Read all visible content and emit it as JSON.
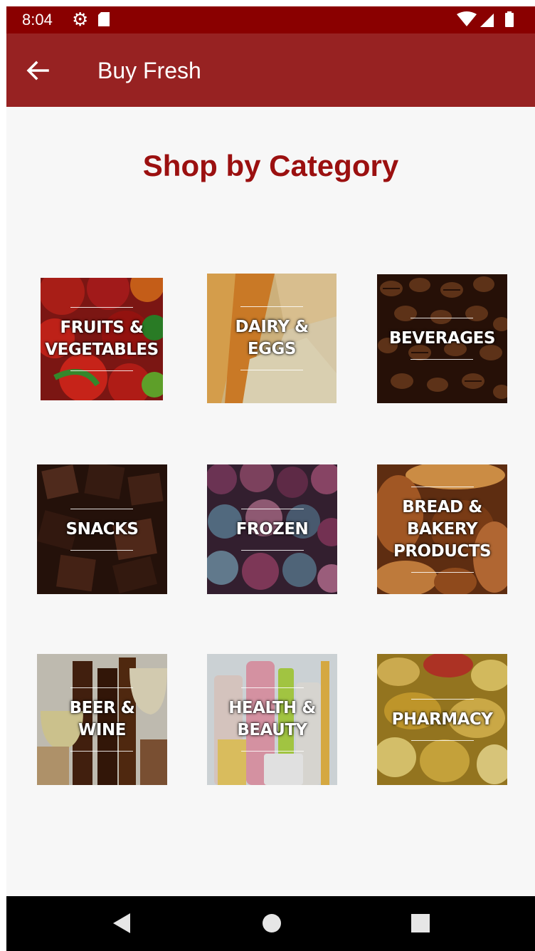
{
  "status_bar": {
    "time": "8:04",
    "icons": [
      "gear-icon",
      "sd-card-icon",
      "wifi-icon",
      "signal-icon",
      "battery-icon"
    ]
  },
  "app_bar": {
    "title": "Buy Fresh",
    "back_icon": "arrow-left-icon",
    "color": "#972222"
  },
  "heading": "Shop by Category",
  "accent_color": "#9b1010",
  "categories": [
    {
      "label": "FRUITS &\nVEGETABLES",
      "image": "fruits-vegetables"
    },
    {
      "label": "DAIRY &\nEGGS",
      "image": "dairy-eggs"
    },
    {
      "label": "BEVERAGES",
      "image": "coffee-beans"
    },
    {
      "label": "SNACKS",
      "image": "chocolate"
    },
    {
      "label": "FROZEN",
      "image": "frozen-berries"
    },
    {
      "label": "BREAD &\nBAKERY\nPRODUCTS",
      "image": "bread"
    },
    {
      "label": "BEER &\nWINE",
      "image": "beer-wine"
    },
    {
      "label": "HEALTH &\nBEAUTY",
      "image": "toiletries"
    },
    {
      "label": "PHARMACY",
      "image": "capsules"
    }
  ],
  "nav_bar": {
    "buttons": [
      "back-triangle-icon",
      "home-circle-icon",
      "recents-square-icon"
    ]
  }
}
